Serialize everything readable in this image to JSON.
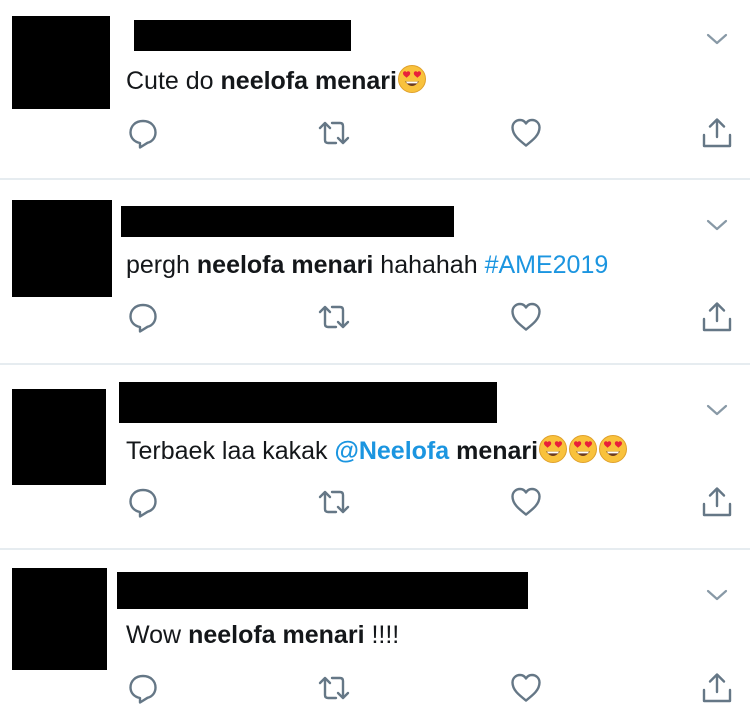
{
  "tweets": [
    {
      "parts": [
        {
          "t": "Cute do ",
          "s": "normal"
        },
        {
          "t": "neelofa menari",
          "s": "bold"
        }
      ],
      "emoji_count": 1
    },
    {
      "parts": [
        {
          "t": "pergh ",
          "s": "normal"
        },
        {
          "t": "neelofa menari",
          "s": "bold"
        },
        {
          "t": " hahahah ",
          "s": "normal"
        },
        {
          "t": "#AME2019",
          "s": "link"
        }
      ],
      "emoji_count": 0
    },
    {
      "parts": [
        {
          "t": "Terbaek laa kakak ",
          "s": "normal"
        },
        {
          "t": "@Neelofa",
          "s": "linkbold"
        },
        {
          "t": " menari",
          "s": "bold"
        }
      ],
      "emoji_count": 3
    },
    {
      "parts": [
        {
          "t": "Wow ",
          "s": "normal"
        },
        {
          "t": "neelofa menari",
          "s": "bold"
        },
        {
          "t": " !!!!",
          "s": "normal"
        }
      ],
      "emoji_count": 0
    }
  ],
  "icons": {
    "reply": "reply-icon",
    "retweet": "retweet-icon",
    "like": "heart-icon",
    "share": "share-icon",
    "more": "chevron-down-icon",
    "emoji": "heart-eyes-emoji"
  },
  "colors": {
    "text": "#14171a",
    "link": "#1b95e0",
    "icon": "#657786",
    "divider": "#e6ecf0"
  }
}
